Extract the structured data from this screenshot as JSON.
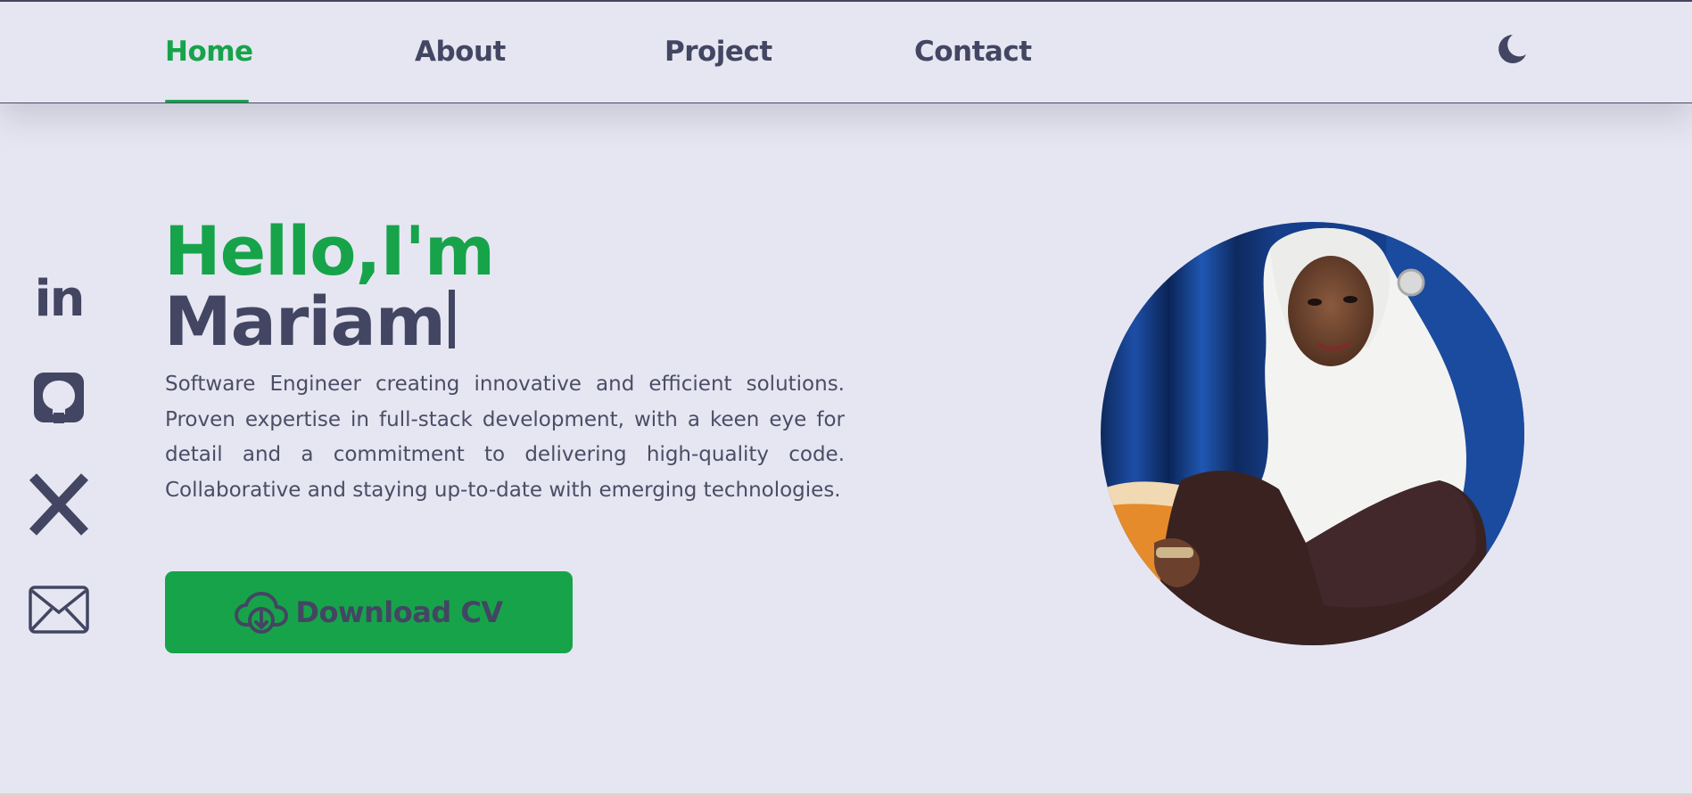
{
  "nav": {
    "items": [
      {
        "label": "Home",
        "active": true
      },
      {
        "label": "About",
        "active": false
      },
      {
        "label": "Project",
        "active": false
      },
      {
        "label": "Contact",
        "active": false
      }
    ],
    "theme_toggle_icon": "moon-icon"
  },
  "social": [
    {
      "icon": "linkedin-icon"
    },
    {
      "icon": "github-icon"
    },
    {
      "icon": "x-icon"
    },
    {
      "icon": "mail-icon"
    }
  ],
  "hero": {
    "greeting": "Hello,I'm",
    "name": "Mariam",
    "bio": "Software Engineer creating innovative and efficient solutions. Proven expertise in full-stack development, with a keen eye for detail and a commitment to delivering high-quality code. Collaborative and staying up-to-date with emerging technologies.",
    "cv_button_label": "Download CV",
    "cv_button_icon": "cloud-download-icon"
  },
  "colors": {
    "accent": "#17a34a",
    "text": "#434662",
    "background": "#e6e6f2"
  }
}
